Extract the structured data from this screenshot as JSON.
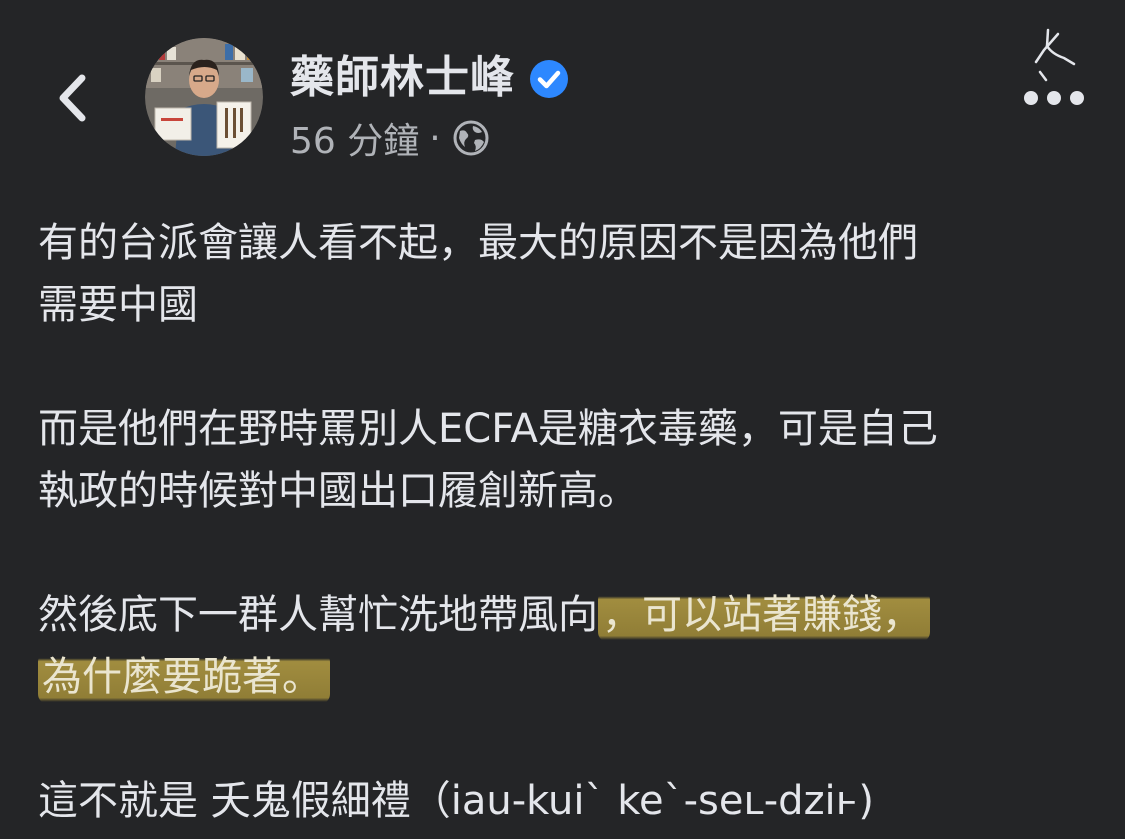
{
  "header": {
    "author_name": "藥師林士峰",
    "verified_icon": "verified-badge-icon",
    "timestamp": "56 分鐘",
    "separator": "·",
    "audience_icon": "globe-icon",
    "back_icon": "chevron-left-icon",
    "more_icon": "ellipsis-icon",
    "brand_mark_icon": "handwritten-logo-icon"
  },
  "post": {
    "paragraphs": [
      {
        "lines": [
          "有的台派會讓人看不起，最大的原因不是因為他們",
          "需要中國"
        ]
      },
      {
        "lines": [
          "而是他們在野時罵別人ECFA是糖衣毒藥，可是自己",
          "執政的時候對中國出口履創新高。"
        ]
      },
      {
        "line1_plain": "然後底下一群人幫忙洗地帶風向",
        "line1_highlight": "，可以站著賺錢，",
        "line2_highlight": "為什麼要跪著。"
      },
      {
        "lines": [
          "這不就是 夭鬼假細禮（iau-kuiˋ keˋ-seʟ-dziⱶ)"
        ]
      }
    ]
  },
  "colors": {
    "background": "#242527",
    "text": "#e4e6eb",
    "secondary_text": "#b0b3b8",
    "verified_blue": "#2d88ff",
    "highlight": "#c4aa46"
  }
}
